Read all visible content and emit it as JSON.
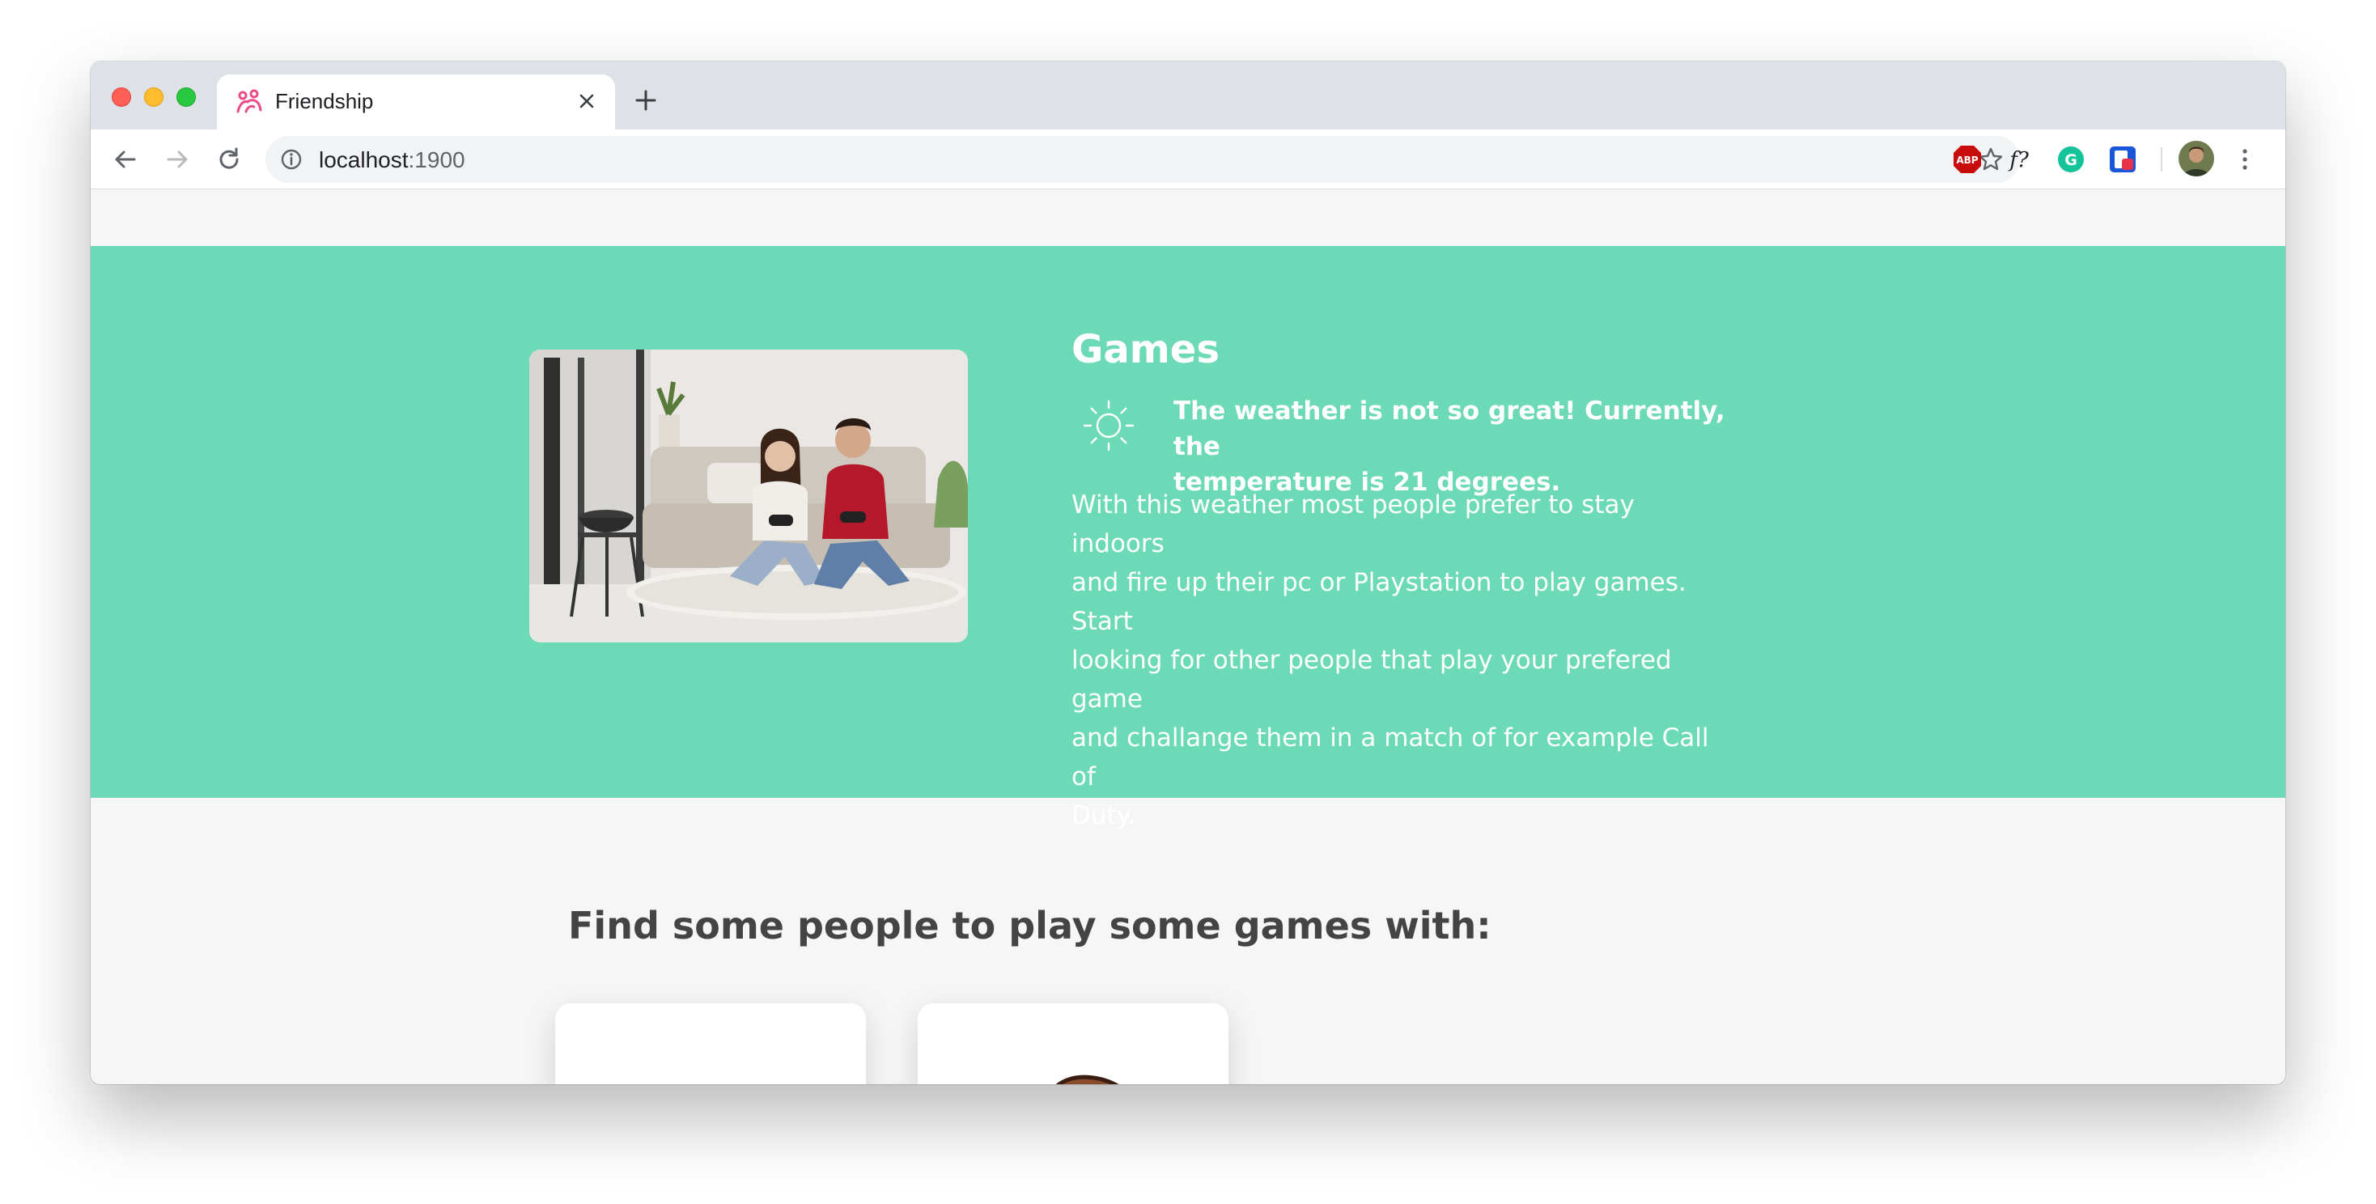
{
  "browser": {
    "tab": {
      "title": "Friendship",
      "favicon": "friendship-logo-icon",
      "close_icon": "close-icon"
    },
    "new_tab_icon": "plus-icon",
    "toolbar": {
      "back_icon": "arrow-left-icon",
      "forward_icon": "arrow-right-icon",
      "reload_icon": "reload-icon",
      "url_host": "localhost",
      "url_port": ":1900",
      "info_icon": "info-icon",
      "bookmark_icon": "star-icon"
    },
    "extensions": [
      {
        "name": "adblock-plus-icon",
        "label": "ABP"
      },
      {
        "name": "fontface-ninja-icon",
        "label": "f?"
      },
      {
        "name": "grammarly-icon",
        "label": "G"
      },
      {
        "name": "pocket-icon",
        "label": ""
      }
    ],
    "menu_icon": "kebab-menu-icon"
  },
  "hero": {
    "background": "#6cdab6",
    "title": "Games",
    "weather_icon": "sun-icon",
    "weather_line_1": "The weather is not so great! Currently, the",
    "weather_line_2": "temperature is 21 degrees.",
    "description_lines": [
      "With this weather most people prefer to stay indoors",
      "and fire up their pc or Playstation to play games. Start",
      "looking for other people that play your prefered game",
      "and challange them in a match of for example Call of",
      "Duty."
    ]
  },
  "people": {
    "heading": "Find some people to play some games with:"
  }
}
